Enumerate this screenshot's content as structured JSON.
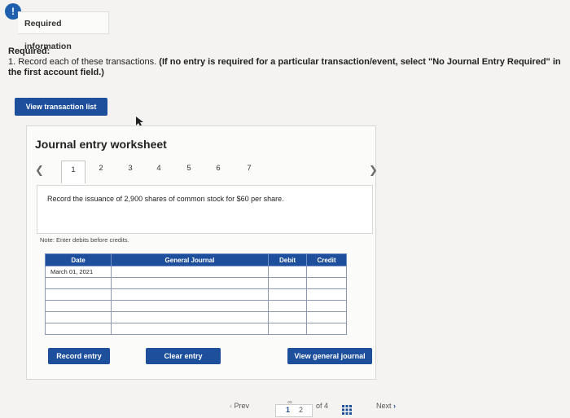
{
  "header": {
    "info_icon": "!",
    "tab_label": "Required information"
  },
  "required": {
    "heading": "Required:",
    "instruction": "1. Record each of these transactions.",
    "note_bold": "(If no entry is required for a particular transaction/event, select \"No Journal Entry Required\" in the first account field.)"
  },
  "buttons": {
    "view_transactions": "View transaction list",
    "record_entry": "Record entry",
    "clear_entry": "Clear entry",
    "view_general_journal": "View general journal"
  },
  "worksheet": {
    "title": "Journal entry worksheet",
    "tabs": [
      "1",
      "2",
      "3",
      "4",
      "5",
      "6",
      "7"
    ],
    "active_tab": "1",
    "description": "Record the issuance of 2,900 shares of common stock for $60 per share.",
    "note": "Note: Enter debits before credits."
  },
  "table": {
    "headers": {
      "date": "Date",
      "general_journal": "General Journal",
      "debit": "Debit",
      "credit": "Credit"
    },
    "rows": [
      {
        "date": "March 01, 2021"
      },
      {
        "date": ""
      },
      {
        "date": ""
      },
      {
        "date": ""
      },
      {
        "date": ""
      },
      {
        "date": ""
      }
    ]
  },
  "pager": {
    "prev_label": "Prev",
    "page_current": "1",
    "page_other": "2",
    "of_label": "of 4",
    "next_label": "Next"
  },
  "colors": {
    "accent": "#1d4f9c",
    "badge": "#1f5fae"
  }
}
